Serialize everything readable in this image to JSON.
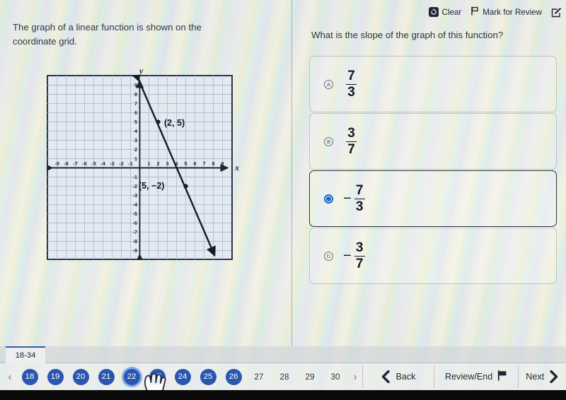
{
  "stimulus": {
    "text": "The graph of a linear function is shown on the coordinate grid."
  },
  "toolbar": {
    "clear_label": "Clear",
    "clear_icon": "undo-circular-arrow-icon",
    "mark_label": "Mark for Review",
    "mark_icon": "flag-outline-icon",
    "edit_icon": "pencil-square-icon"
  },
  "question": {
    "text": "What is the slope of the graph of this function?"
  },
  "choices": [
    {
      "letter": "A",
      "sign": "",
      "numerator": "7",
      "denominator": "3",
      "selected": false
    },
    {
      "letter": "B",
      "sign": "",
      "numerator": "3",
      "denominator": "7",
      "selected": false
    },
    {
      "letter": "C",
      "sign": "−",
      "numerator": "7",
      "denominator": "3",
      "selected": true
    },
    {
      "letter": "D",
      "sign": "−",
      "numerator": "3",
      "denominator": "7",
      "selected": false
    }
  ],
  "bottom": {
    "tab_label": "18-34",
    "prev_arrow": "‹",
    "next_arrow": "›",
    "pages": [
      {
        "label": "18",
        "style": "disc",
        "current": false
      },
      {
        "label": "19",
        "style": "disc",
        "current": false
      },
      {
        "label": "20",
        "style": "disc",
        "current": false
      },
      {
        "label": "21",
        "style": "disc",
        "current": false
      },
      {
        "label": "22",
        "style": "disc",
        "current": true
      },
      {
        "label": "23",
        "style": "disc",
        "current": false
      },
      {
        "label": "24",
        "style": "disc",
        "current": false
      },
      {
        "label": "25",
        "style": "disc",
        "current": false
      },
      {
        "label": "26",
        "style": "disc",
        "current": false
      },
      {
        "label": "27",
        "style": "plain",
        "current": false
      },
      {
        "label": "28",
        "style": "plain",
        "current": false
      },
      {
        "label": "29",
        "style": "plain",
        "current": false
      },
      {
        "label": "30",
        "style": "plain",
        "current": false
      }
    ],
    "back_label": "Back",
    "back_icon": "chevron-left-icon",
    "review_label": "Review/End",
    "review_icon": "flag-filled-icon",
    "next_label": "Next",
    "next_icon": "chevron-right-icon"
  },
  "colors": {
    "accent_blue": "#2b56b0",
    "radio_blue": "#1767c4",
    "ink": "#1d2533",
    "grid_line": "#aebfd4",
    "grid_border": "#2a3446"
  },
  "chart_data": {
    "type": "line",
    "title": "",
    "xlabel": "x",
    "ylabel": "y",
    "xlim": [
      -9.5,
      9.5
    ],
    "ylim": [
      -9.5,
      9.5
    ],
    "xticks": [
      -9,
      -8,
      -7,
      -6,
      -5,
      -4,
      -3,
      -2,
      -1,
      1,
      2,
      3,
      4,
      5,
      6,
      7,
      8,
      9
    ],
    "yticks": [
      -9,
      -8,
      -7,
      -6,
      -5,
      -4,
      -3,
      -2,
      -1,
      1,
      2,
      3,
      4,
      5,
      6,
      7,
      8,
      9
    ],
    "grid": true,
    "legend": "none",
    "series": [
      {
        "name": "linear function",
        "slope": -2.3333,
        "intercept": 9.6667,
        "line_from": [
          -0.0714,
          9.5
        ],
        "line_to": [
          8.1429,
          -9.5
        ],
        "arrow_both_ends": true,
        "points": [
          {
            "x": 2,
            "y": 5,
            "label": "(2, 5)"
          },
          {
            "x": 5,
            "y": -2,
            "label": "(5, −2)"
          }
        ]
      }
    ]
  }
}
